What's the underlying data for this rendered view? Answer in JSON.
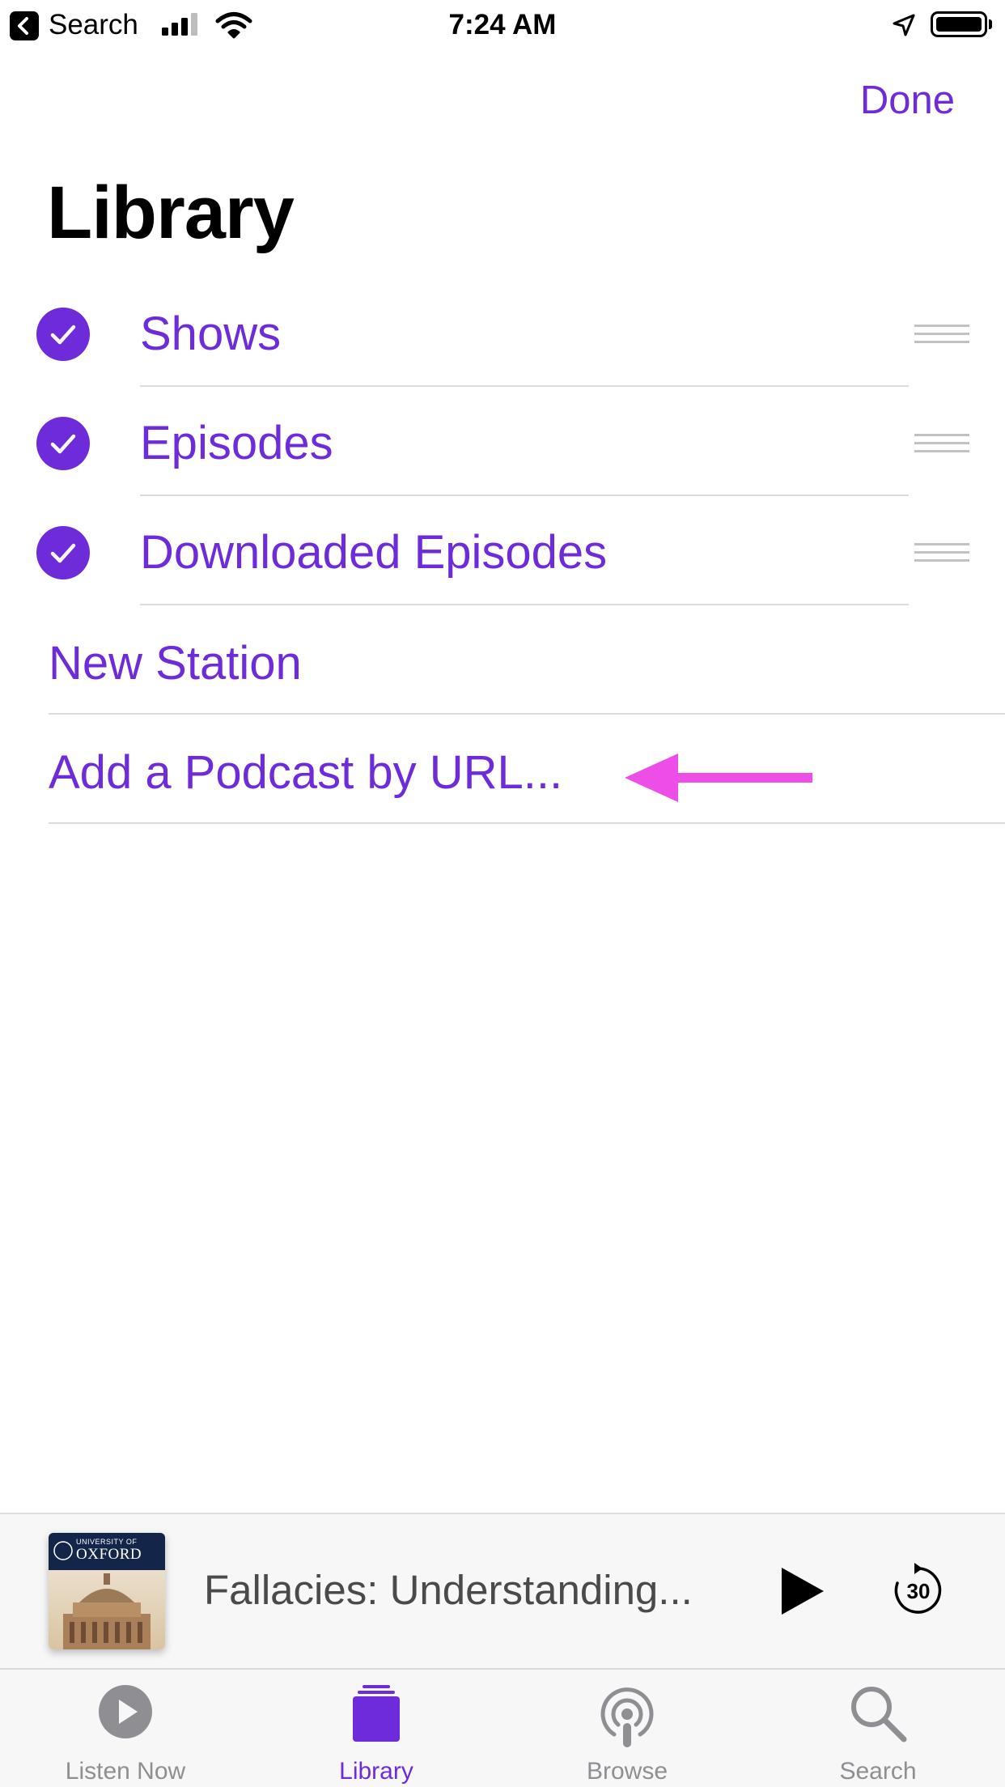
{
  "status_bar": {
    "back_app_label": "Search",
    "time": "7:24 AM"
  },
  "nav": {
    "done_label": "Done",
    "title": "Library"
  },
  "library_items": [
    {
      "label": "Shows",
      "checked": true
    },
    {
      "label": "Episodes",
      "checked": true
    },
    {
      "label": "Downloaded Episodes",
      "checked": true
    }
  ],
  "actions": [
    {
      "label": "New Station"
    },
    {
      "label": "Add a Podcast by URL..."
    }
  ],
  "annotation": {
    "arrow_color": "#ee4ee8",
    "points_to": "Add a Podcast by URL..."
  },
  "mini_player": {
    "title": "Fallacies: Understanding...",
    "artwork": {
      "top_line": "UNIVERSITY OF",
      "name": "OXFORD"
    },
    "skip_seconds": "30"
  },
  "tabs": [
    {
      "label": "Listen Now",
      "icon": "play-circle-icon",
      "active": false
    },
    {
      "label": "Library",
      "icon": "library-stack-icon",
      "active": true
    },
    {
      "label": "Browse",
      "icon": "podcast-antenna-icon",
      "active": false
    },
    {
      "label": "Search",
      "icon": "magnifier-icon",
      "active": false
    }
  ],
  "colors": {
    "accent": "#6e2bd9",
    "tab_inactive": "#8e8e93",
    "separator": "#dcdcdc"
  }
}
